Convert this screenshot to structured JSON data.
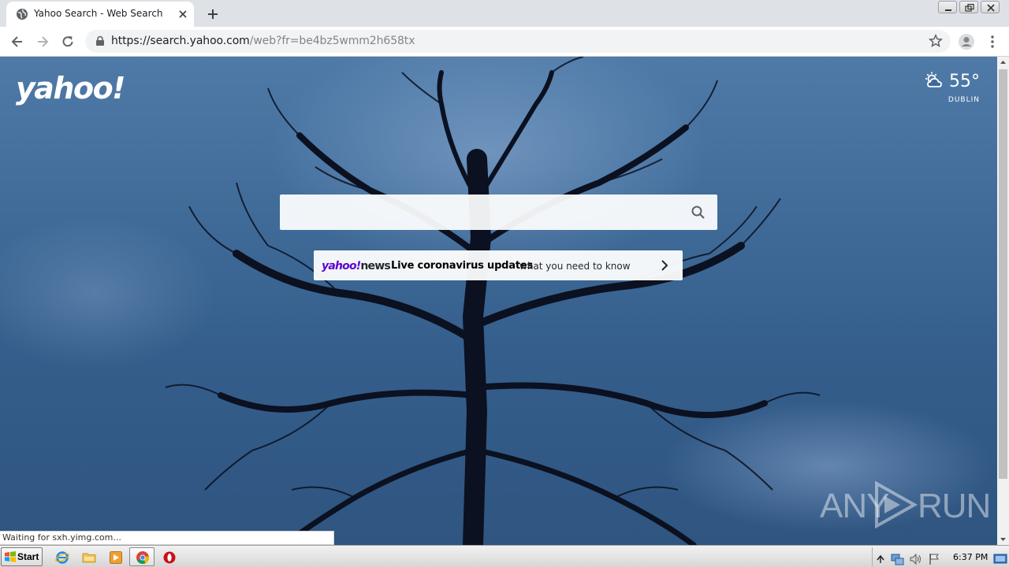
{
  "browser": {
    "tab_title": "Yahoo Search - Web Search",
    "url_host": "https://search.yahoo.com",
    "url_path": "/web?fr=be4bz5wmm2h658tx"
  },
  "page": {
    "logo_text": "yahoo!",
    "weather": {
      "temp": "55°",
      "city": "DUBLIN"
    },
    "search": {
      "placeholder": "",
      "value": ""
    },
    "news": {
      "brand_yahoo": "yahoo!",
      "brand_news": "news",
      "headline": "Live coronavirus updates",
      "subtext": "what you need to know"
    },
    "watermark": {
      "left": "ANY",
      "right": "RUN"
    },
    "status_text": "Waiting for sxh.yimg.com..."
  },
  "taskbar": {
    "start_label": "Start",
    "clock": "6:37 PM"
  },
  "colors": {
    "yahoo_purple": "#6001d2",
    "sky": "#3f6a98"
  }
}
